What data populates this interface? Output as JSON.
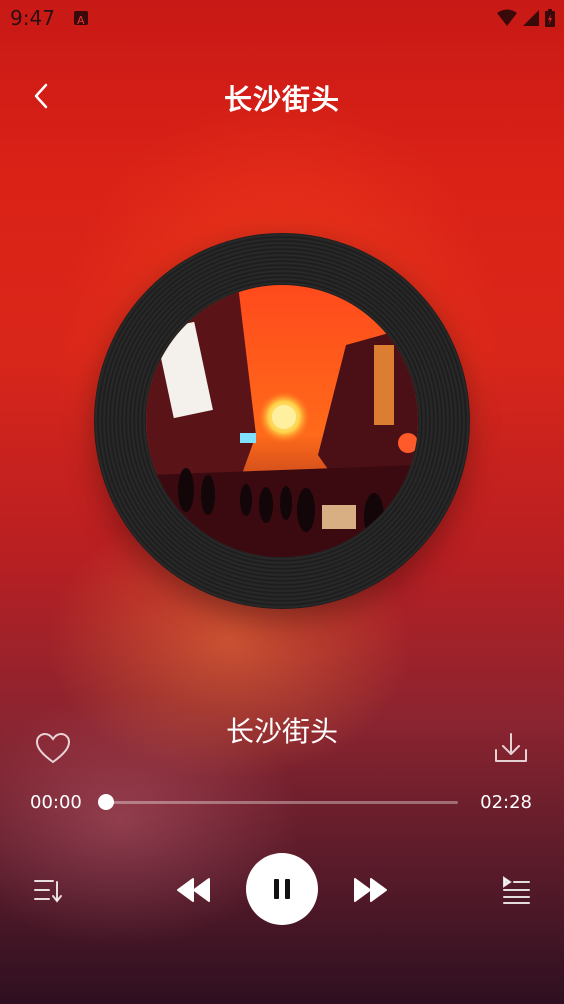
{
  "status_bar": {
    "time": "9:47"
  },
  "header": {
    "title": "长沙街头"
  },
  "player": {
    "song_title": "长沙街头",
    "current_time": "00:00",
    "total_time": "02:28",
    "progress": 0.0
  },
  "icons": {
    "back": "chevron-left-icon",
    "heart": "heart-icon",
    "download": "download-icon",
    "playlist": "playlist-sort-icon",
    "rewind": "rewind-icon",
    "pause": "pause-icon",
    "forward": "fast-forward-icon",
    "queue": "queue-icon"
  }
}
